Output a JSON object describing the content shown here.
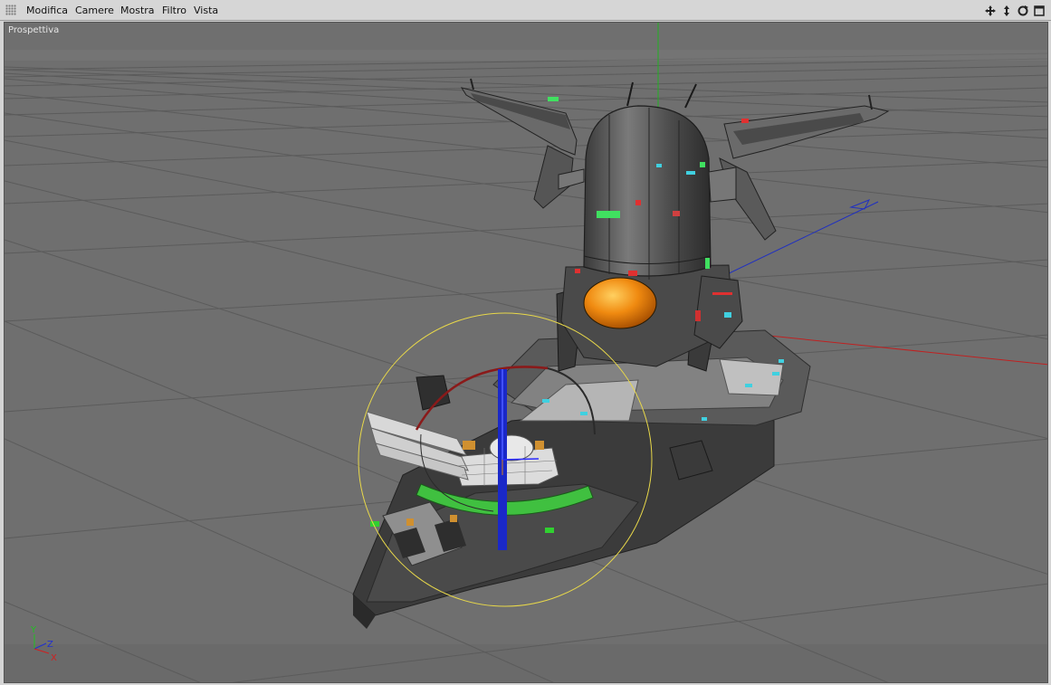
{
  "menubar": {
    "items": [
      "Modifica",
      "Camere",
      "Mostra",
      "Filtro",
      "Vista"
    ],
    "nav_icons": [
      "move-view-icon",
      "dolly-view-icon",
      "rotate-view-icon",
      "maximize-view-icon"
    ]
  },
  "viewport": {
    "label": "Prospettiva",
    "axes": {
      "y": "Y",
      "z": "Z",
      "x": "X"
    }
  },
  "colors": {
    "background": "#6f6f6f",
    "grid": "#5a5a5a",
    "x_axis": "#c02020",
    "y_axis": "#20b020",
    "z_axis": "#2030c0",
    "selection_circle": "#e8d84a",
    "visor_orange": "#f08a10"
  }
}
